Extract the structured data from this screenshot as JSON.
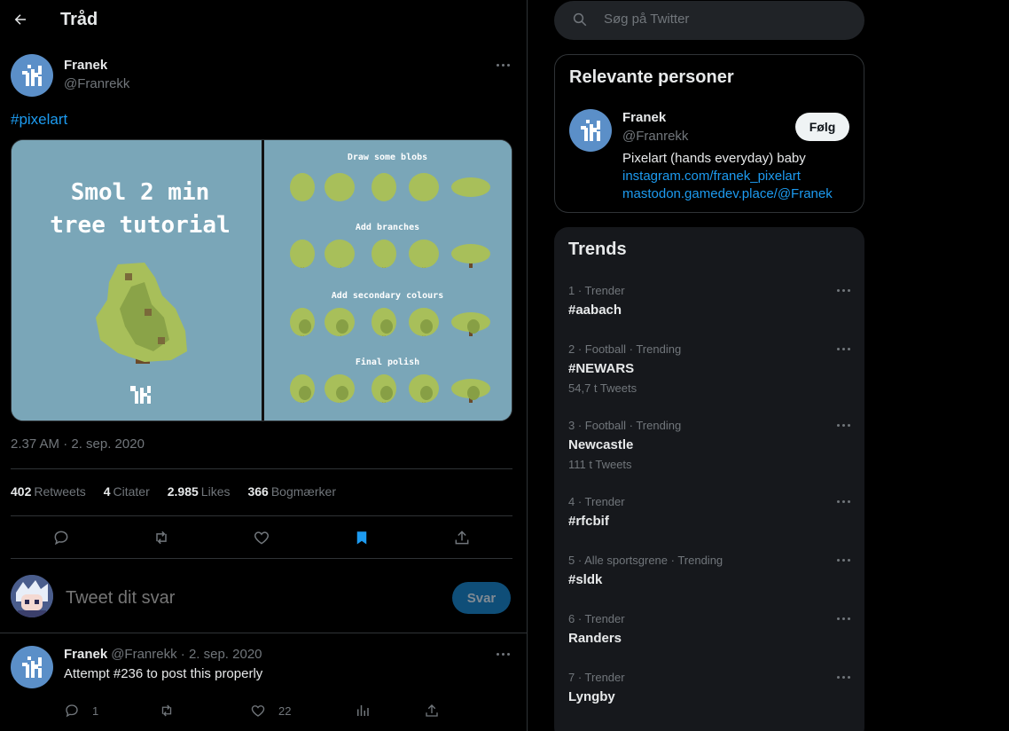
{
  "header": {
    "title": "Tråd"
  },
  "post": {
    "name": "Franek",
    "handle": "@Franrekk",
    "hashtag": "#pixelart",
    "media": {
      "left_title_line1": "Smol 2 min",
      "left_title_line2": "tree tutorial",
      "steps": [
        "Draw some blobs",
        "Add branches",
        "Add secondary colours",
        "Final polish"
      ]
    },
    "timestamp": "2.37 AM · 2. sep. 2020",
    "stats": [
      {
        "value": "402",
        "label": "Retweets"
      },
      {
        "value": "4",
        "label": "Citater"
      },
      {
        "value": "2.985",
        "label": "Likes"
      },
      {
        "value": "366",
        "label": "Bogmærker"
      }
    ]
  },
  "reply": {
    "placeholder": "Tweet dit svar",
    "button": "Svar"
  },
  "reply_tweet": {
    "name": "Franek",
    "meta": "@Franrekk · 2. sep. 2020",
    "text": "Attempt #236 to post this properly",
    "reply_count": "1",
    "like_count": "22"
  },
  "search": {
    "placeholder": "Søg på Twitter"
  },
  "people": {
    "title": "Relevante personer",
    "name": "Franek",
    "handle": "@Franrekk",
    "follow": "Følg",
    "bio": "Pixelart (hands everyday) baby",
    "link1": "instagram.com/franek_pixelart",
    "link2": "mastodon.gamedev.place/@Franek"
  },
  "trends": {
    "title": "Trends",
    "items": [
      {
        "meta": "1 · Trender",
        "name": "#aabach",
        "count": ""
      },
      {
        "meta": "2 · Football · Trending",
        "name": "#NEWARS",
        "count": "54,7 t Tweets"
      },
      {
        "meta": "3 · Football · Trending",
        "name": "Newcastle",
        "count": "111 t Tweets"
      },
      {
        "meta": "4 · Trender",
        "name": "#rfcbif",
        "count": ""
      },
      {
        "meta": "5 · Alle sportsgrene · Trending",
        "name": "#sldk",
        "count": ""
      },
      {
        "meta": "6 · Trender",
        "name": "Randers",
        "count": ""
      },
      {
        "meta": "7 · Trender",
        "name": "Lyngby",
        "count": ""
      }
    ]
  },
  "colors": {
    "accent": "#1d9bf0",
    "background": "#000000",
    "panel": "#16181c",
    "bookmark_active": "#1d9bf0"
  }
}
